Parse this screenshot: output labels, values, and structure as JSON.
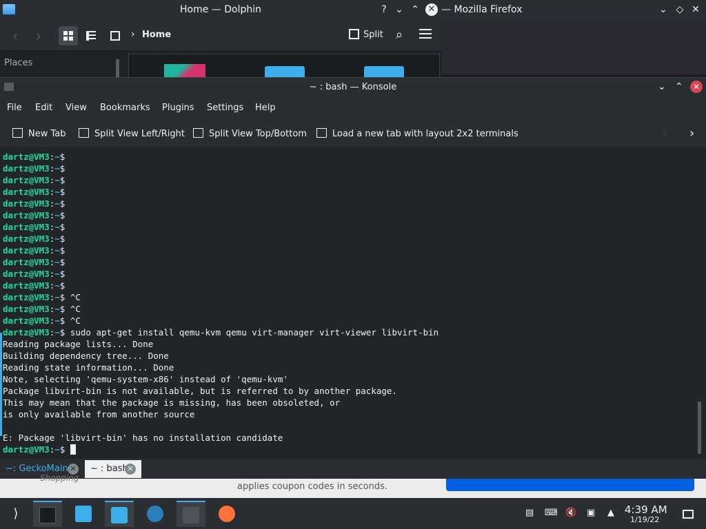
{
  "topbar": {
    "dolphin_title": "Home — Dolphin",
    "help": "?",
    "min": "⌄",
    "max": "⌃",
    "close": "✕",
    "firefox_title": "— Mozilla Firefox",
    "ff_min": "⌄",
    "ff_restore": "◇",
    "ff_close": "✕"
  },
  "dolphin": {
    "back": "‹",
    "forward": "›",
    "breadcrumb": "Home",
    "split_label": "Split",
    "places_label": "Places"
  },
  "konsole": {
    "title": "~ : bash — Konsole",
    "menu": [
      "File",
      "Edit",
      "View",
      "Bookmarks",
      "Plugins",
      "Settings",
      "Help"
    ],
    "toolbar": {
      "new_tab": "New Tab",
      "split_lr": "Split View Left/Right",
      "split_tb": "Split View Top/Bottom",
      "layout_2x2": "Load a new tab with layout 2x2 terminals"
    },
    "prompt": {
      "user": "dartz@VM3",
      "sep": ":",
      "path": "~",
      "dollar": "$"
    },
    "lines": [
      {
        "type": "prompt",
        "cmd": ""
      },
      {
        "type": "prompt",
        "cmd": ""
      },
      {
        "type": "prompt",
        "cmd": ""
      },
      {
        "type": "prompt",
        "cmd": ""
      },
      {
        "type": "prompt",
        "cmd": ""
      },
      {
        "type": "prompt",
        "cmd": ""
      },
      {
        "type": "prompt",
        "cmd": ""
      },
      {
        "type": "prompt",
        "cmd": ""
      },
      {
        "type": "prompt",
        "cmd": ""
      },
      {
        "type": "prompt",
        "cmd": ""
      },
      {
        "type": "prompt",
        "cmd": ""
      },
      {
        "type": "prompt",
        "cmd": ""
      },
      {
        "type": "prompt",
        "cmd": " ^C"
      },
      {
        "type": "prompt",
        "cmd": " ^C"
      },
      {
        "type": "prompt",
        "cmd": " ^C"
      },
      {
        "type": "prompt",
        "cmd": " sudo apt-get install qemu-kvm qemu virt-manager virt-viewer libvirt-bin"
      },
      {
        "type": "out",
        "text": "Reading package lists... Done"
      },
      {
        "type": "out",
        "text": "Building dependency tree... Done"
      },
      {
        "type": "out",
        "text": "Reading state information... Done"
      },
      {
        "type": "out",
        "text": "Note, selecting 'qemu-system-x86' instead of 'qemu-kvm'"
      },
      {
        "type": "out",
        "text": "Package libvirt-bin is not available, but is referred to by another package."
      },
      {
        "type": "out",
        "text": "This may mean that the package is missing, has been obsoleted, or"
      },
      {
        "type": "out",
        "text": "is only available from another source"
      },
      {
        "type": "out",
        "text": ""
      },
      {
        "type": "out",
        "text": "E: Package 'libvirt-bin' has no installation candidate"
      },
      {
        "type": "cursor",
        "cmd": " "
      }
    ],
    "tabs": [
      {
        "label": "~: GeckoMain",
        "active": false
      },
      {
        "label": "~ : bash",
        "active": true
      }
    ]
  },
  "firefox_bg": {
    "coupon_text": "applies coupon codes in seconds.",
    "shopping_text": "Shopping"
  },
  "taskbar": {
    "time": "4:39 AM",
    "date": "1/19/22"
  },
  "colors": {
    "prompt_user": "#1cdc9a",
    "prompt_path": "#3daee9",
    "accent": "#3daee9",
    "close_red": "#da4453"
  }
}
